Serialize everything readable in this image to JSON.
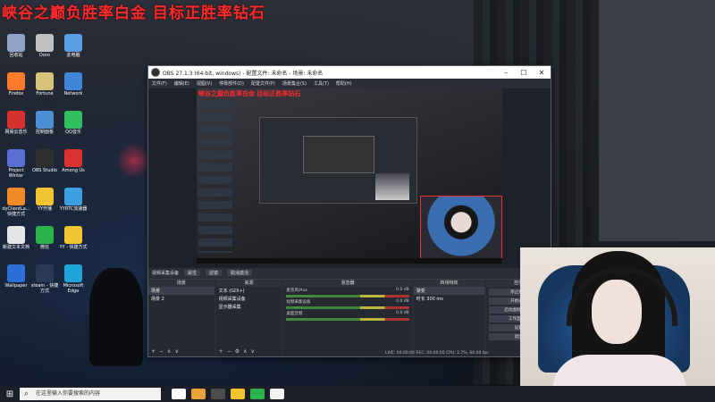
{
  "banner": {
    "text": "峡谷之巅负胜率白金  目标正胜率钻石"
  },
  "desktop_icons": [
    {
      "label": "回收站",
      "color": "#8fa3c8"
    },
    {
      "label": "Doro",
      "color": "#c0c0c0"
    },
    {
      "label": "此电脑",
      "color": "#5a9ee8"
    },
    {
      "label": "Firefox",
      "color": "#ff7a2a"
    },
    {
      "label": "Fortune",
      "color": "#d7c27a"
    },
    {
      "label": "Network",
      "color": "#3f86d8"
    },
    {
      "label": "网易云音乐",
      "color": "#d4312f"
    },
    {
      "label": "控制面板",
      "color": "#4c8fd4"
    },
    {
      "label": "QQ音乐",
      "color": "#30c060"
    },
    {
      "label": "Project Winter",
      "color": "#5a6ecf"
    },
    {
      "label": "OBS Studio",
      "color": "#302e31"
    },
    {
      "label": "Among Us",
      "color": "#d93030"
    },
    {
      "label": "dyClientLa... 快捷方式",
      "color": "#f08a24"
    },
    {
      "label": "YY开播",
      "color": "#f2c430"
    },
    {
      "label": "YYRTC加速器",
      "color": "#3aa0e0"
    },
    {
      "label": "新建文本文档",
      "color": "#e6e6e6"
    },
    {
      "label": "微信",
      "color": "#2ab34a"
    },
    {
      "label": "YY - 快捷方式",
      "color": "#f2c430"
    },
    {
      "label": "Wallpaper",
      "color": "#2d6fd6"
    },
    {
      "label": "steam - 快捷方式",
      "color": "#2a3a55"
    },
    {
      "label": "Microsoft Edge",
      "color": "#1fa3d9"
    }
  ],
  "obs": {
    "title": "OBS 27.1.3 (64-bit, windows) - 配置文件: 未命名 - 场景: 未命名",
    "menus": [
      "文件(F)",
      "编辑(E)",
      "视图(V)",
      "停靠部件(D)",
      "配置文件(P)",
      "场景集合(S)",
      "工具(T)",
      "帮助(H)"
    ],
    "preview_banner": "峡谷之巅负胜率白金  目标正胜率钻石",
    "scene_bar": {
      "source_name": "视频采集设备",
      "properties": "属性",
      "filters": "滤镜",
      "deactivate": "取消激活"
    },
    "scenes": {
      "header": "场景",
      "items": [
        "场景",
        "场景 2"
      ]
    },
    "sources": {
      "header": "来源",
      "items": [
        "文本 (GDI+)",
        "视频采集设备",
        "显示器采集"
      ]
    },
    "mixer": {
      "header": "混音器",
      "tracks": [
        {
          "name": "麦克风/Aux",
          "db": "0.0 dB"
        },
        {
          "name": "视频采集设备",
          "db": "0.0 dB"
        },
        {
          "name": "桌面音频",
          "db": "0.0 dB"
        }
      ]
    },
    "transitions": {
      "header": "转场特效",
      "type": "渐变",
      "duration_label": "时长",
      "duration": "300 ms"
    },
    "controls": {
      "header": "控件",
      "buttons": [
        "停止推流",
        "开始录制",
        "启动虚拟摄像机",
        "工作室模式",
        "设置",
        "退出"
      ]
    },
    "status": "LIVE: 00:00:00   REC: 00:00:00   CPU: 2.7%, 60.00 fps"
  },
  "taskbar": {
    "search_placeholder": "在这里输入你要搜索的内容",
    "apps": [
      "#ffffff",
      "#e8a23a",
      "#4c4c4c",
      "#f2c430",
      "#2ab34a",
      "#f2f2f2"
    ]
  }
}
